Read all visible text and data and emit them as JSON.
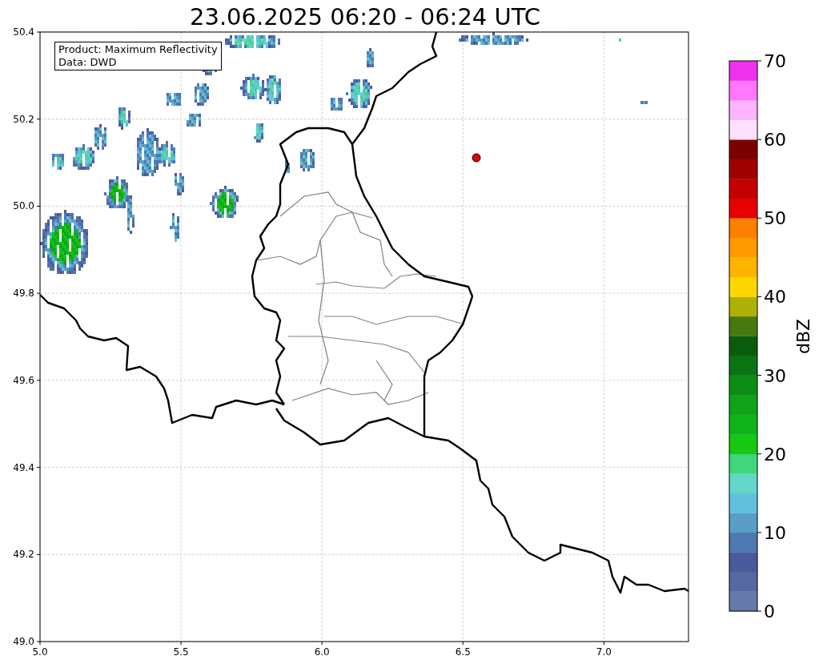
{
  "title": "23.06.2025 06:20 - 06:24 UTC",
  "info_box": {
    "lines": [
      "Product: Maximum Reflectivity",
      "Data: DWD"
    ]
  },
  "map": {
    "xtick_labels": [
      "5.0",
      "5.5",
      "6.0",
      "6.5",
      "7.0"
    ],
    "ytick_labels": [
      "50.4",
      "50.2",
      "50.0",
      "49.8",
      "49.6",
      "49.4",
      "49.2",
      "49.0"
    ]
  },
  "colorbar": {
    "label": "dBZ",
    "tick_labels": [
      "70",
      "60",
      "50",
      "40",
      "30",
      "20",
      "10",
      "0"
    ],
    "segments": [
      {
        "color": "#6779a8"
      },
      {
        "color": "#5868a0"
      },
      {
        "color": "#4a5a9c"
      },
      {
        "color": "#4d78b0"
      },
      {
        "color": "#5a9ec8"
      },
      {
        "color": "#62c0dc"
      },
      {
        "color": "#64d6c8"
      },
      {
        "color": "#40d67a"
      },
      {
        "color": "#14c814"
      },
      {
        "color": "#10b41a"
      },
      {
        "color": "#0ea318"
      },
      {
        "color": "#0c8c14"
      },
      {
        "color": "#0a7414"
      },
      {
        "color": "#0a5c0c"
      },
      {
        "color": "#487810"
      },
      {
        "color": "#b0b00a"
      },
      {
        "color": "#ffd700"
      },
      {
        "color": "#ffb400"
      },
      {
        "color": "#ff9b00"
      },
      {
        "color": "#ff7f00"
      },
      {
        "color": "#e60000"
      },
      {
        "color": "#c30000"
      },
      {
        "color": "#a00000"
      },
      {
        "color": "#7d0000"
      },
      {
        "color": "#ffe1ff"
      },
      {
        "color": "#ffb4ff"
      },
      {
        "color": "#ff78ff"
      },
      {
        "color": "#ee32ee"
      }
    ]
  }
}
